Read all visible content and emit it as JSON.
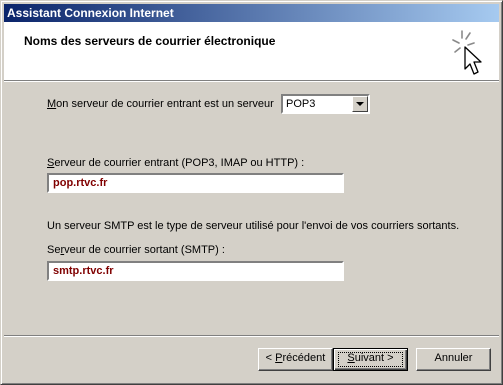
{
  "window": {
    "title": "Assistant Connexion Internet"
  },
  "header": {
    "title": "Noms des serveurs de courrier électronique",
    "icon": "wizard-sparkle-cursor-icon"
  },
  "incoming_type": {
    "label_pre": "",
    "label_accel": "M",
    "label_post": "on serveur de courrier entrant est un serveur",
    "selected": "POP3"
  },
  "incoming_server": {
    "label_pre": "",
    "label_accel": "S",
    "label_post": "erveur de courrier entrant (POP3, IMAP ou HTTP) :",
    "value": "pop.rtvc.fr"
  },
  "smtp_info": "Un serveur SMTP est le type de serveur utilisé pour l'envoi de vos courriers sortants.",
  "outgoing_server": {
    "label_pre": "Se",
    "label_accel": "r",
    "label_post": "veur de courrier sortant (SMTP) :",
    "value": "smtp.rtvc.fr"
  },
  "buttons": {
    "back_pre": "< ",
    "back_accel": "P",
    "back_post": "récédent",
    "next_pre": "",
    "next_accel": "S",
    "next_post": "uivant >",
    "cancel": "Annuler"
  }
}
